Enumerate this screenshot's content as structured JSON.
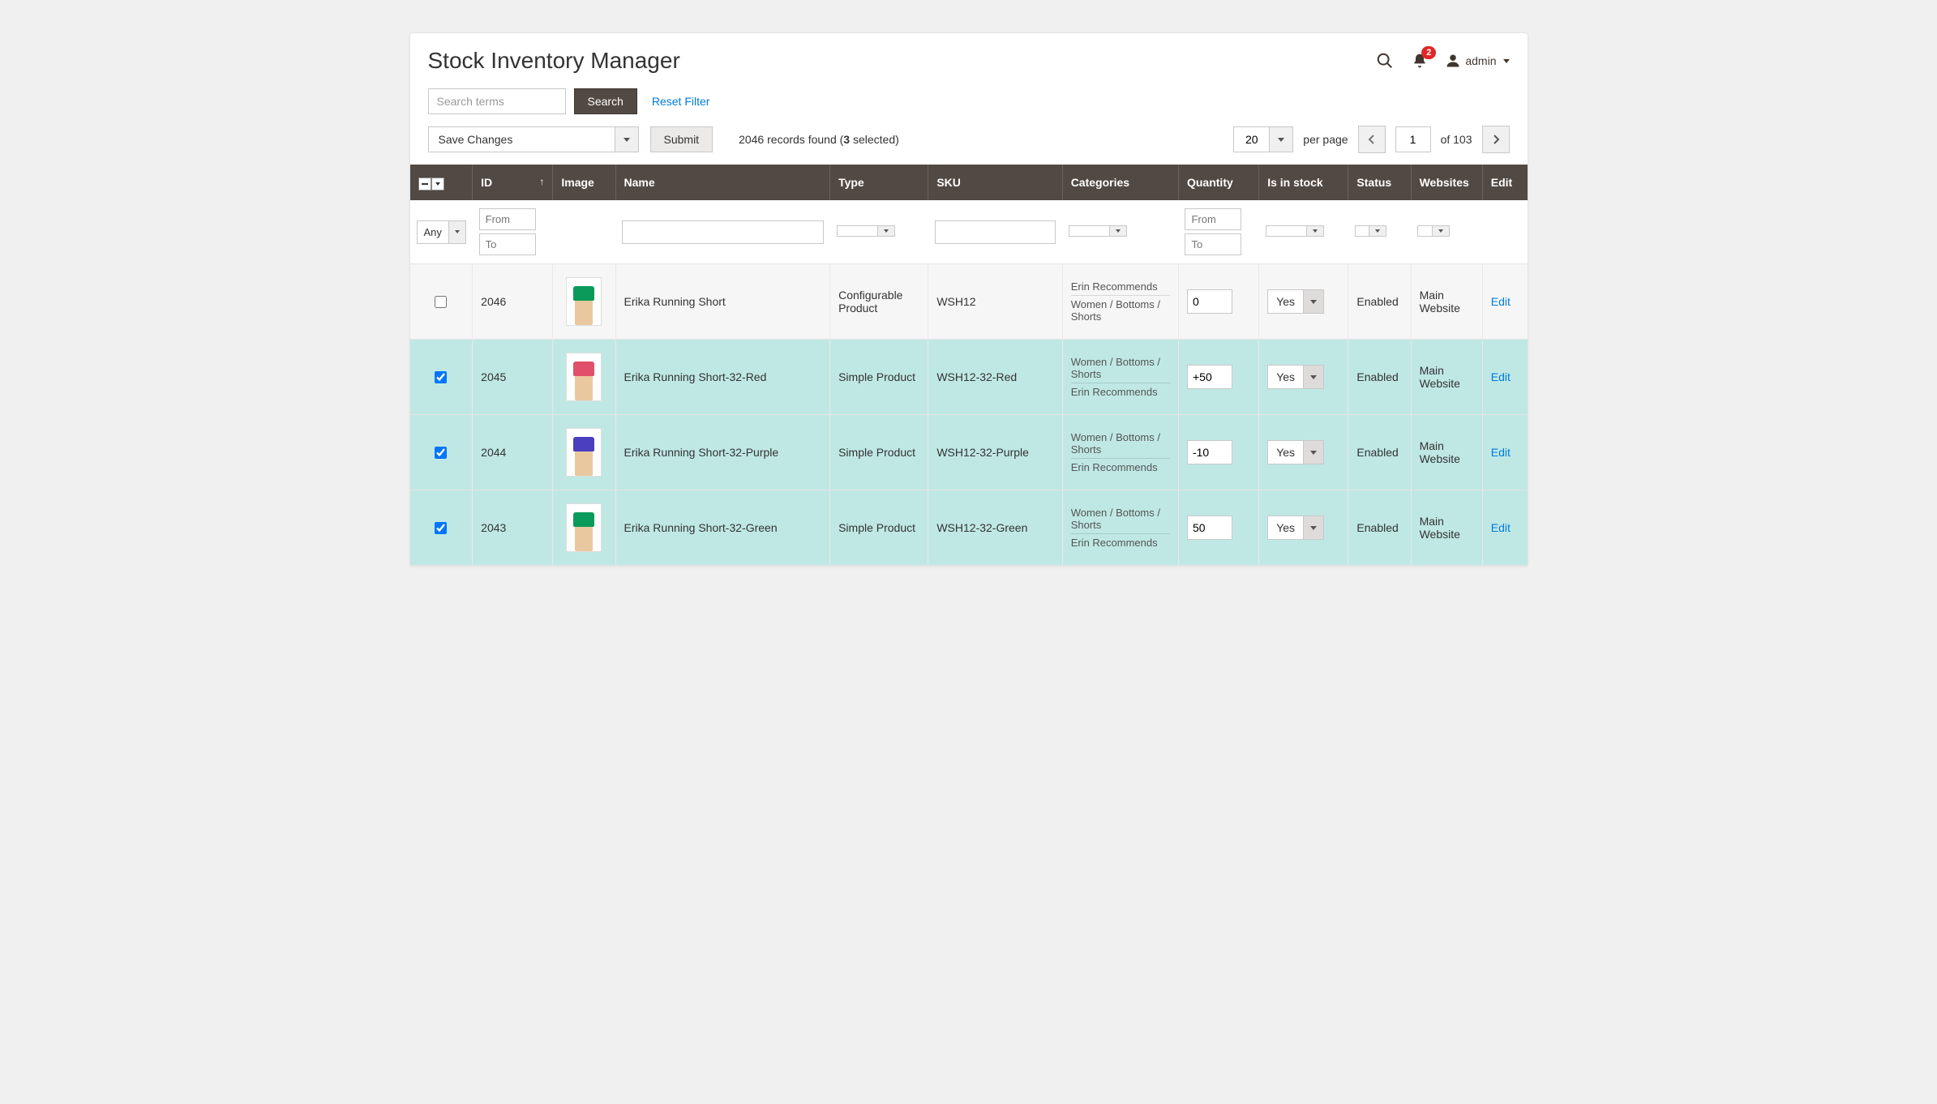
{
  "header": {
    "title": "Stock Inventory Manager",
    "notification_count": "2",
    "user_name": "admin"
  },
  "toolbar": {
    "search_placeholder": "Search terms",
    "search_button": "Search",
    "reset_filter": "Reset Filter",
    "mass_action": "Save Changes",
    "submit": "Submit",
    "records_found_count": "2046",
    "records_found_label": "records found",
    "selected_count": "3",
    "selected_label": "selected",
    "per_page_value": "20",
    "per_page_label": "per page",
    "current_page": "1",
    "of_label": "of",
    "total_pages": "103"
  },
  "columns": {
    "id": "ID",
    "image": "Image",
    "name": "Name",
    "type": "Type",
    "sku": "SKU",
    "categories": "Categories",
    "quantity": "Quantity",
    "in_stock": "Is in stock",
    "status": "Status",
    "websites": "Websites",
    "edit": "Edit"
  },
  "filters": {
    "any": "Any",
    "from": "From",
    "to": "To"
  },
  "rows": [
    {
      "checked": false,
      "id": "2046",
      "name": "Erika Running Short",
      "type": "Configurable Product",
      "sku": "WSH12",
      "categories": [
        "Erin Recommends",
        "Women / Bottoms / Shorts"
      ],
      "qty": "0",
      "in_stock": "Yes",
      "status": "Enabled",
      "websites": "Main Website",
      "edit": "Edit",
      "short_color": "#0a9b5a"
    },
    {
      "checked": true,
      "id": "2045",
      "name": "Erika Running Short-32-Red",
      "type": "Simple Product",
      "sku": "WSH12-32-Red",
      "categories": [
        "Women / Bottoms / Shorts",
        "Erin Recommends"
      ],
      "qty": "+50",
      "in_stock": "Yes",
      "status": "Enabled",
      "websites": "Main Website",
      "edit": "Edit",
      "short_color": "#e0506a"
    },
    {
      "checked": true,
      "id": "2044",
      "name": "Erika Running Short-32-Purple",
      "type": "Simple Product",
      "sku": "WSH12-32-Purple",
      "categories": [
        "Women / Bottoms / Shorts",
        "Erin Recommends"
      ],
      "qty": "-10",
      "in_stock": "Yes",
      "status": "Enabled",
      "websites": "Main Website",
      "edit": "Edit",
      "short_color": "#4a3fbf"
    },
    {
      "checked": true,
      "id": "2043",
      "name": "Erika Running Short-32-Green",
      "type": "Simple Product",
      "sku": "WSH12-32-Green",
      "categories": [
        "Women / Bottoms / Shorts",
        "Erin Recommends"
      ],
      "qty": "50",
      "in_stock": "Yes",
      "status": "Enabled",
      "websites": "Main Website",
      "edit": "Edit",
      "short_color": "#0a9b5a"
    }
  ]
}
